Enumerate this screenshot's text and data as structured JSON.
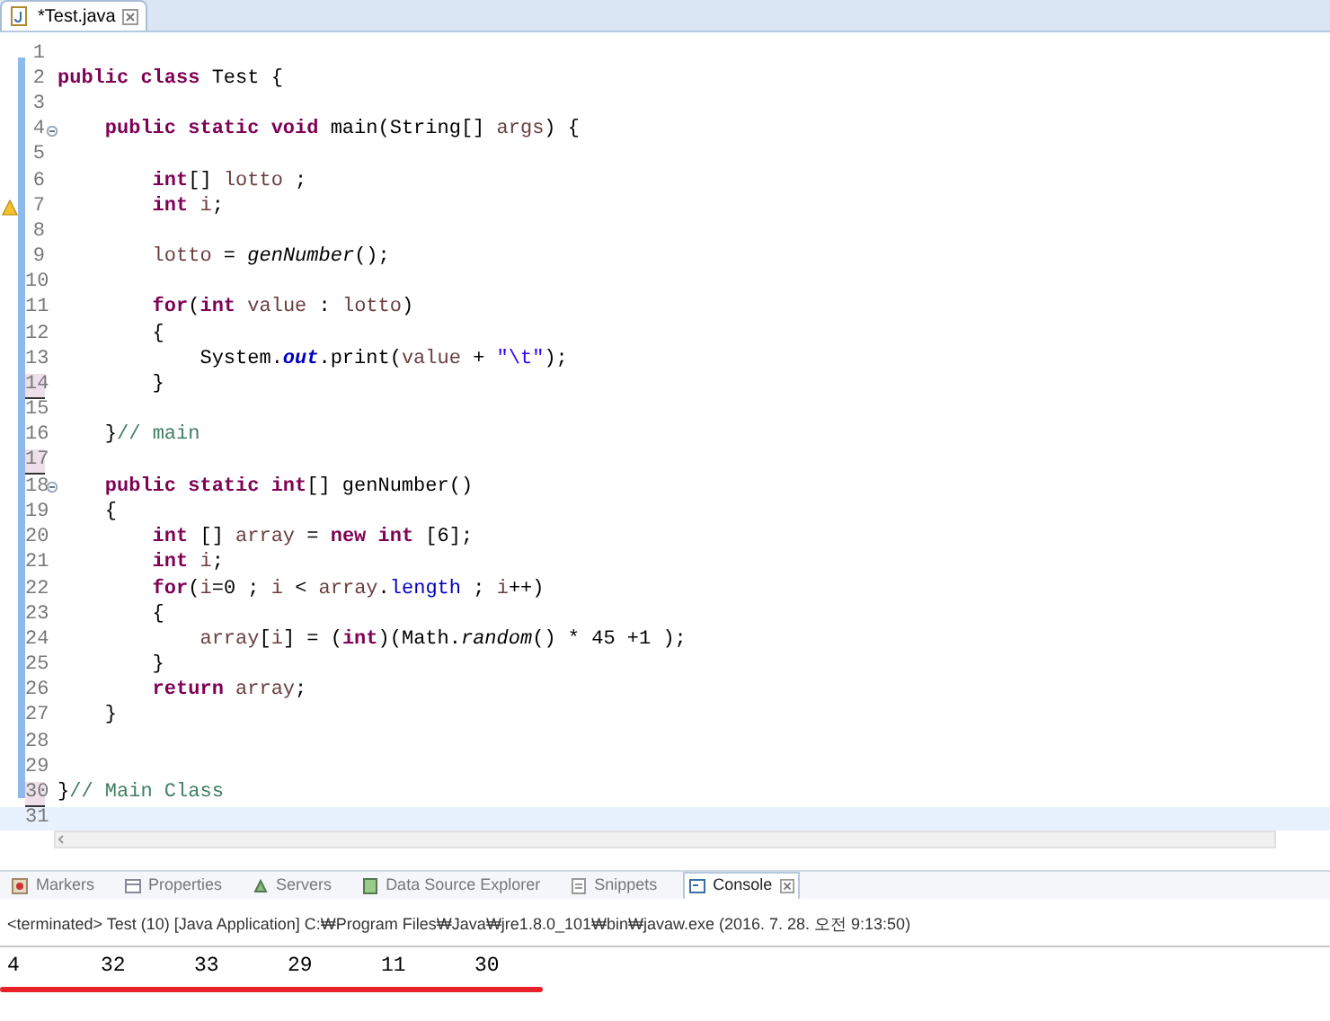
{
  "editor": {
    "tab": {
      "title": "*Test.java",
      "selected": true
    },
    "lines": [
      {
        "number": "1",
        "marked": false,
        "warning": false,
        "foldable": false,
        "current": false
      },
      {
        "number": "2",
        "marked": false,
        "warning": false,
        "foldable": false,
        "current": false,
        "tokens": [
          {
            "kind": "keyword",
            "text": "public class"
          },
          {
            "kind": "plain",
            "text": " Test {"
          }
        ]
      },
      {
        "number": "3",
        "marked": false,
        "warning": false,
        "foldable": false,
        "current": false
      },
      {
        "number": "4",
        "marked": false,
        "warning": false,
        "foldable": true,
        "current": false,
        "tokens": [
          {
            "kind": "keyword",
            "text": "    public static void"
          },
          {
            "kind": "plain",
            "text": " main(String[] "
          },
          {
            "kind": "variable",
            "text": "args"
          },
          {
            "kind": "plain",
            "text": ") {"
          }
        ]
      },
      {
        "number": "5",
        "marked": false,
        "warning": false,
        "foldable": false,
        "current": false
      },
      {
        "number": "6",
        "marked": false,
        "warning": false,
        "foldable": false,
        "current": false,
        "tokens": [
          {
            "kind": "keyword",
            "text": "        int"
          },
          {
            "kind": "plain",
            "text": "[] "
          },
          {
            "kind": "variable",
            "text": "lotto"
          },
          {
            "kind": "plain",
            "text": " ;"
          }
        ]
      },
      {
        "number": "7",
        "marked": false,
        "warning": true,
        "foldable": false,
        "current": false,
        "tokens": [
          {
            "kind": "keyword",
            "text": "        int "
          },
          {
            "kind": "variable",
            "text": "i"
          },
          {
            "kind": "plain",
            "text": ";"
          }
        ]
      },
      {
        "number": "8",
        "marked": false,
        "warning": false,
        "foldable": false,
        "current": false
      },
      {
        "number": "9",
        "marked": false,
        "warning": false,
        "foldable": false,
        "current": false,
        "tokens": [
          {
            "kind": "variable",
            "text": "        lotto"
          },
          {
            "kind": "plain",
            "text": " = "
          },
          {
            "kind": "method",
            "text": "genNumber"
          },
          {
            "kind": "plain",
            "text": "();"
          }
        ]
      },
      {
        "number": "10",
        "marked": false,
        "warning": false,
        "foldable": false,
        "current": false
      },
      {
        "number": "11",
        "marked": false,
        "warning": false,
        "foldable": false,
        "current": false,
        "tokens": [
          {
            "kind": "keyword",
            "text": "        for"
          },
          {
            "kind": "plain",
            "text": "("
          },
          {
            "kind": "keyword",
            "text": "int "
          },
          {
            "kind": "variable",
            "text": "value"
          },
          {
            "kind": "plain",
            "text": " : "
          },
          {
            "kind": "variable",
            "text": "lotto"
          },
          {
            "kind": "plain",
            "text": ")"
          }
        ]
      },
      {
        "number": "12",
        "marked": false,
        "warning": false,
        "foldable": false,
        "current": false,
        "tokens": [
          {
            "kind": "plain",
            "text": "        {"
          }
        ]
      },
      {
        "number": "13",
        "marked": false,
        "warning": false,
        "foldable": false,
        "current": false,
        "tokens": [
          {
            "kind": "plain",
            "text": "            System."
          },
          {
            "kind": "static-field",
            "text": "out"
          },
          {
            "kind": "plain",
            "text": ".print("
          },
          {
            "kind": "variable",
            "text": "value"
          },
          {
            "kind": "plain",
            "text": " + "
          },
          {
            "kind": "string",
            "text": "\"\\t\""
          },
          {
            "kind": "plain",
            "text": ");"
          }
        ]
      },
      {
        "number": "14",
        "marked": true,
        "warning": false,
        "foldable": false,
        "current": false,
        "tokens": [
          {
            "kind": "plain",
            "text": "        }"
          }
        ]
      },
      {
        "number": "15",
        "marked": false,
        "warning": false,
        "foldable": false,
        "current": false
      },
      {
        "number": "16",
        "marked": false,
        "warning": false,
        "foldable": false,
        "current": false,
        "tokens": [
          {
            "kind": "plain",
            "text": "    }"
          },
          {
            "kind": "comment",
            "text": "// main"
          }
        ]
      },
      {
        "number": "17",
        "marked": true,
        "warning": false,
        "foldable": false,
        "current": false
      },
      {
        "number": "18",
        "marked": false,
        "warning": false,
        "foldable": true,
        "current": false,
        "tokens": [
          {
            "kind": "keyword",
            "text": "    public static int"
          },
          {
            "kind": "plain",
            "text": "[] genNumber()"
          }
        ]
      },
      {
        "number": "19",
        "marked": false,
        "warning": false,
        "foldable": false,
        "current": false,
        "tokens": [
          {
            "kind": "plain",
            "text": "    {"
          }
        ]
      },
      {
        "number": "20",
        "marked": false,
        "warning": false,
        "foldable": false,
        "current": false,
        "tokens": [
          {
            "kind": "keyword",
            "text": "        int"
          },
          {
            "kind": "plain",
            "text": " [] "
          },
          {
            "kind": "variable",
            "text": "array"
          },
          {
            "kind": "plain",
            "text": " = "
          },
          {
            "kind": "keyword",
            "text": "new int"
          },
          {
            "kind": "plain",
            "text": " [6];"
          }
        ]
      },
      {
        "number": "21",
        "marked": false,
        "warning": false,
        "foldable": false,
        "current": false,
        "tokens": [
          {
            "kind": "keyword",
            "text": "        int "
          },
          {
            "kind": "variable",
            "text": "i"
          },
          {
            "kind": "plain",
            "text": ";"
          }
        ]
      },
      {
        "number": "22",
        "marked": false,
        "warning": false,
        "foldable": false,
        "current": false,
        "tokens": [
          {
            "kind": "keyword",
            "text": "        for"
          },
          {
            "kind": "plain",
            "text": "("
          },
          {
            "kind": "variable",
            "text": "i"
          },
          {
            "kind": "plain",
            "text": "=0 ; "
          },
          {
            "kind": "variable",
            "text": "i"
          },
          {
            "kind": "plain",
            "text": " < "
          },
          {
            "kind": "variable",
            "text": "array"
          },
          {
            "kind": "plain",
            "text": "."
          },
          {
            "kind": "field",
            "text": "length"
          },
          {
            "kind": "plain",
            "text": " ; "
          },
          {
            "kind": "variable",
            "text": "i"
          },
          {
            "kind": "plain",
            "text": "++)"
          }
        ]
      },
      {
        "number": "23",
        "marked": false,
        "warning": false,
        "foldable": false,
        "current": false,
        "tokens": [
          {
            "kind": "plain",
            "text": "        {"
          }
        ]
      },
      {
        "number": "24",
        "marked": false,
        "warning": false,
        "foldable": false,
        "current": false,
        "tokens": [
          {
            "kind": "variable",
            "text": "            array"
          },
          {
            "kind": "plain",
            "text": "["
          },
          {
            "kind": "variable",
            "text": "i"
          },
          {
            "kind": "plain",
            "text": "] = ("
          },
          {
            "kind": "keyword",
            "text": "int"
          },
          {
            "kind": "plain",
            "text": ")(Math."
          },
          {
            "kind": "method",
            "text": "random"
          },
          {
            "kind": "plain",
            "text": "() * 45 +1 );"
          }
        ]
      },
      {
        "number": "25",
        "marked": false,
        "warning": false,
        "foldable": false,
        "current": false,
        "tokens": [
          {
            "kind": "plain",
            "text": "        }"
          }
        ]
      },
      {
        "number": "26",
        "marked": false,
        "warning": false,
        "foldable": false,
        "current": false,
        "tokens": [
          {
            "kind": "keyword",
            "text": "        return "
          },
          {
            "kind": "variable",
            "text": "array"
          },
          {
            "kind": "plain",
            "text": ";"
          }
        ]
      },
      {
        "number": "27",
        "marked": false,
        "warning": false,
        "foldable": false,
        "current": false,
        "tokens": [
          {
            "kind": "plain",
            "text": "    }"
          }
        ]
      },
      {
        "number": "28",
        "marked": false,
        "warning": false,
        "foldable": false,
        "current": false
      },
      {
        "number": "29",
        "marked": false,
        "warning": false,
        "foldable": false,
        "current": false
      },
      {
        "number": "30",
        "marked": true,
        "warning": false,
        "foldable": false,
        "current": false,
        "tokens": [
          {
            "kind": "plain",
            "text": "}"
          },
          {
            "kind": "comment",
            "text": "// Main Class"
          }
        ]
      },
      {
        "number": "31",
        "marked": false,
        "warning": false,
        "foldable": false,
        "current": true
      }
    ]
  },
  "bottom_panel": {
    "tabs": [
      {
        "label": "Markers",
        "selected": false
      },
      {
        "label": "Properties",
        "selected": false
      },
      {
        "label": "Servers",
        "selected": false
      },
      {
        "label": "Data Source Explorer",
        "selected": false
      },
      {
        "label": "Snippets",
        "selected": false
      },
      {
        "label": "Console",
        "selected": true
      }
    ],
    "console_header": "<terminated> Test (10) [Java Application] C:₩Program Files₩Java₩jre1.8.0_101₩bin₩javaw.exe (2016. 7. 28. 오전 9:13:50)",
    "output": [
      "4",
      "32",
      "33",
      "29",
      "11",
      "30"
    ]
  }
}
